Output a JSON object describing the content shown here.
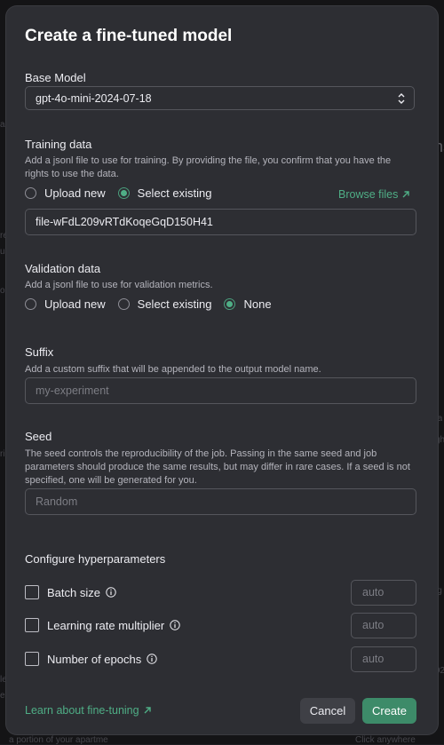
{
  "background": {
    "fragments": [
      "as",
      "Ins",
      "re",
      "ua",
      "o",
      "ri",
      "le",
      "ec",
      "ta",
      "gh",
      "ig",
      "92",
      "a portion of your apartme",
      "Click anywhere"
    ]
  },
  "modal": {
    "title": "Create a fine-tuned model",
    "base_model": {
      "label": "Base Model",
      "value": "gpt-4o-mini-2024-07-18"
    },
    "training": {
      "label": "Training data",
      "help": "Add a jsonl file to use for training. By providing the file, you confirm that you have the rights to use the data.",
      "options": [
        "Upload new",
        "Select existing"
      ],
      "selected": "Select existing",
      "browse_label": "Browse files",
      "file_value": "file-wFdL209vRTdKoqeGqD150H41"
    },
    "validation": {
      "label": "Validation data",
      "help": "Add a jsonl file to use for validation metrics.",
      "options": [
        "Upload new",
        "Select existing",
        "None"
      ],
      "selected": "None"
    },
    "suffix": {
      "label": "Suffix",
      "help": "Add a custom suffix that will be appended to the output model name.",
      "placeholder": "my-experiment"
    },
    "seed": {
      "label": "Seed",
      "help": "The seed controls the reproducibility of the job. Passing in the same seed and job parameters should produce the same results, but may differ in rare cases. If a seed is not specified, one will be generated for you.",
      "placeholder": "Random"
    },
    "hyperparameters": {
      "title": "Configure hyperparameters",
      "rows": [
        {
          "label": "Batch size",
          "value": "auto"
        },
        {
          "label": "Learning rate multiplier",
          "value": "auto"
        },
        {
          "label": "Number of epochs",
          "value": "auto"
        }
      ]
    },
    "footer": {
      "learn_link": "Learn about fine-tuning",
      "cancel": "Cancel",
      "create": "Create"
    }
  }
}
